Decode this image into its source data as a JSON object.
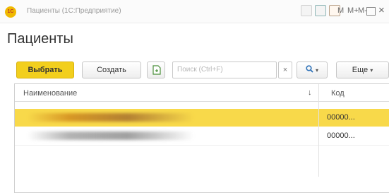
{
  "window": {
    "logo": "1С",
    "title": "Пациенты  (1С:Предприятие)",
    "m_labels": [
      "M",
      "M+",
      "M-"
    ],
    "close": "×"
  },
  "form": {
    "title": "Пациенты"
  },
  "toolbar": {
    "select_label": "Выбрать",
    "create_label": "Создать",
    "search_placeholder": "Поиск (Ctrl+F)",
    "clear_label": "×",
    "more_label": "Еще",
    "dropdown_arrow": "▾"
  },
  "table": {
    "columns": {
      "name": "Наименование",
      "sort_indicator": "↓",
      "code": "Код"
    },
    "rows": [
      {
        "code": "00000...",
        "selected": true
      },
      {
        "code": "00000...",
        "selected": false
      }
    ]
  },
  "colors": {
    "accent": "#f2cf1d",
    "selection": "#f8d94a"
  }
}
